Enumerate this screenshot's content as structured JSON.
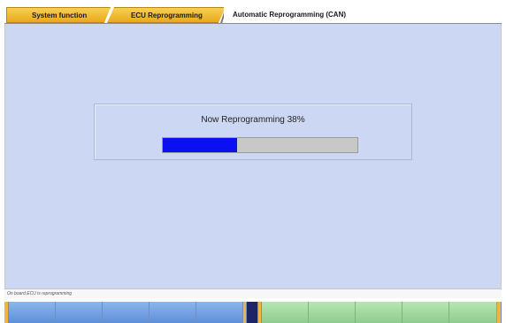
{
  "tabs": [
    {
      "label": "System function"
    },
    {
      "label": "ECU Reprogramming"
    },
    {
      "label": "Automatic Reprogramming (CAN)"
    }
  ],
  "dialog": {
    "message": "Now Reprogramming  38%",
    "progress_percent": 38
  },
  "status": {
    "text": "On board ECU is reprogramming"
  },
  "colors": {
    "tab_active_bg": "#e9a91d",
    "main_bg": "#ccd8f3",
    "progress_fill": "#0b10f0",
    "progress_track": "#c8c8c8",
    "fkey_blue": "#5e8fd8",
    "fkey_green": "#8fcc8e",
    "fkey_separator": "#f2b43a"
  }
}
